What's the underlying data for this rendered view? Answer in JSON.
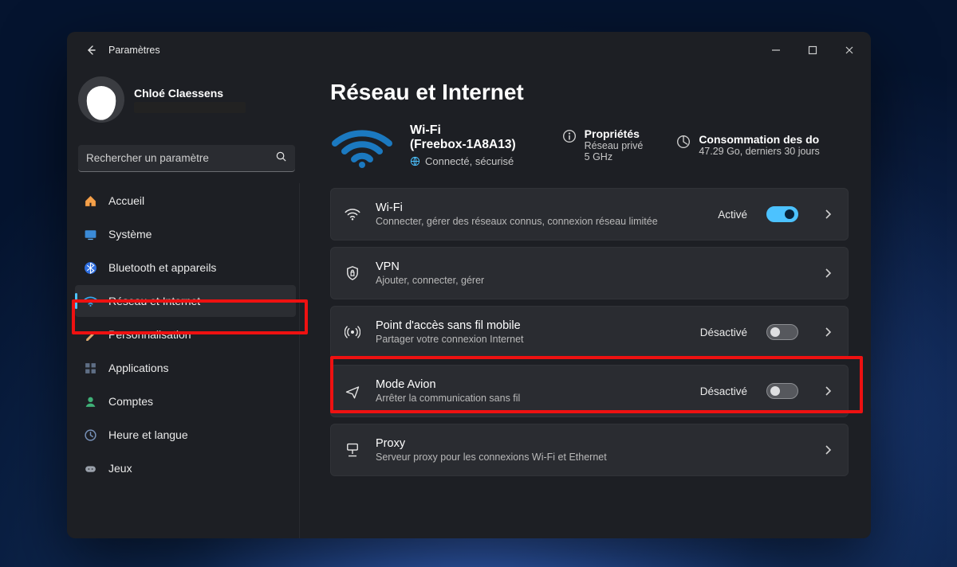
{
  "titlebar": {
    "title": "Paramètres"
  },
  "profile": {
    "name": "Chloé Claessens"
  },
  "search": {
    "placeholder": "Rechercher un paramètre"
  },
  "sidebar": {
    "items": [
      {
        "icon": "home-icon",
        "label": "Accueil"
      },
      {
        "icon": "system-icon",
        "label": "Système"
      },
      {
        "icon": "bluetooth-icon",
        "label": "Bluetooth et appareils"
      },
      {
        "icon": "network-icon",
        "label": "Réseau et Internet",
        "active": true
      },
      {
        "icon": "personalize-icon",
        "label": "Personnalisation"
      },
      {
        "icon": "apps-icon",
        "label": "Applications"
      },
      {
        "icon": "accounts-icon",
        "label": "Comptes"
      },
      {
        "icon": "time-lang-icon",
        "label": "Heure et langue"
      },
      {
        "icon": "gaming-icon",
        "label": "Jeux"
      }
    ]
  },
  "main": {
    "heading": "Réseau et Internet",
    "connection": {
      "line1": "Wi-Fi",
      "line2": "(Freebox-1A8A13)",
      "status": "Connecté, sécurisé"
    },
    "properties": {
      "title": "Propriétés",
      "sub1": "Réseau privé",
      "sub2": "5 GHz"
    },
    "usage": {
      "title": "Consommation des do",
      "sub": "47.29 Go, derniers 30 jours"
    },
    "cards": [
      {
        "icon": "wifi-icon",
        "title": "Wi-Fi",
        "sub": "Connecter, gérer des réseaux connus, connexion réseau limitée",
        "state": "Activé",
        "toggle": "on"
      },
      {
        "icon": "shield-icon",
        "title": "VPN",
        "sub": "Ajouter, connecter, gérer"
      },
      {
        "icon": "hotspot-icon",
        "title": "Point d'accès sans fil mobile",
        "sub": "Partager votre connexion Internet",
        "state": "Désactivé",
        "toggle": "off"
      },
      {
        "icon": "airplane-icon",
        "title": "Mode Avion",
        "sub": "Arrêter la communication sans fil",
        "state": "Désactivé",
        "toggle": "off"
      },
      {
        "icon": "proxy-icon",
        "title": "Proxy",
        "sub": "Serveur proxy pour les connexions Wi-Fi et Ethernet"
      }
    ]
  },
  "colors": {
    "accent": "#4cc2ff",
    "highlight": "#e11"
  }
}
